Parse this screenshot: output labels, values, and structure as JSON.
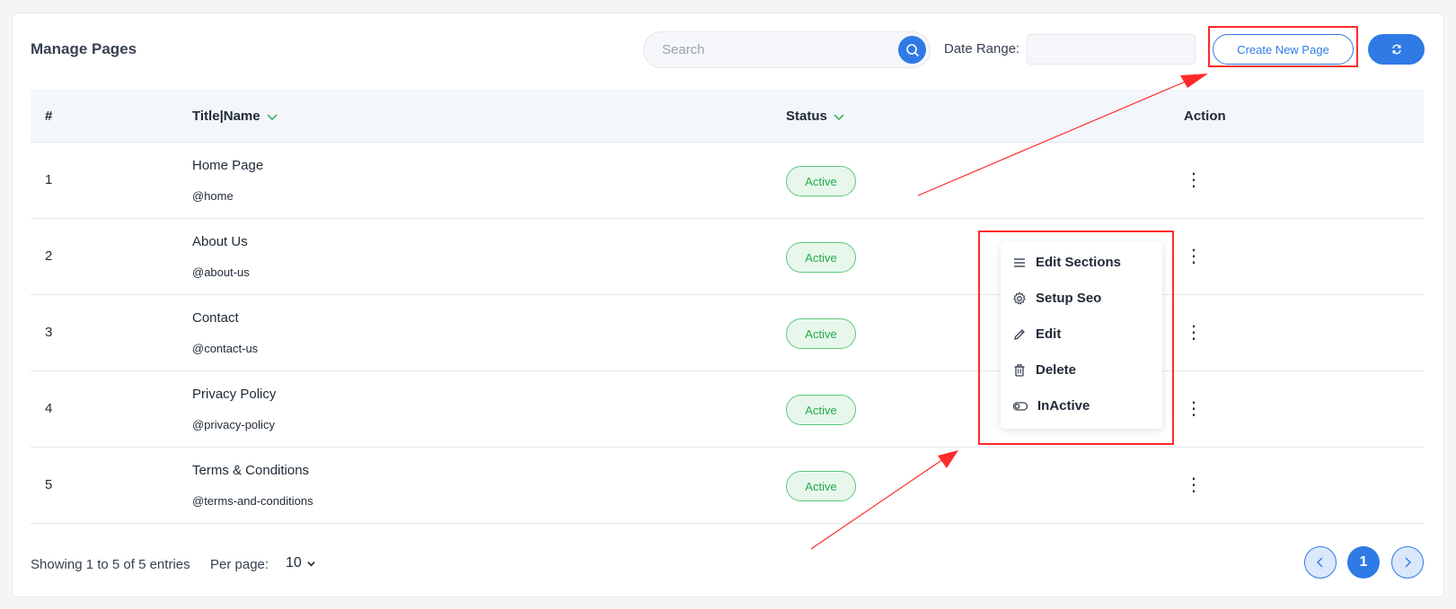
{
  "header": {
    "title": "Manage Pages",
    "search_placeholder": "Search",
    "date_range_label": "Date Range:",
    "create_label": "Create New Page"
  },
  "table": {
    "columns": {
      "num": "#",
      "title": "Title|Name",
      "status": "Status",
      "action": "Action"
    },
    "rows": [
      {
        "num": "1",
        "title": "Home Page",
        "slug": "@home",
        "status": "Active"
      },
      {
        "num": "2",
        "title": "About Us",
        "slug": "@about-us",
        "status": "Active"
      },
      {
        "num": "3",
        "title": "Contact",
        "slug": "@contact-us",
        "status": "Active"
      },
      {
        "num": "4",
        "title": "Privacy Policy",
        "slug": "@privacy-policy",
        "status": "Active"
      },
      {
        "num": "5",
        "title": "Terms & Conditions",
        "slug": "@terms-and-conditions",
        "status": "Active"
      }
    ]
  },
  "action_menu": {
    "items": [
      {
        "label": "Edit Sections",
        "icon": "list-icon"
      },
      {
        "label": "Setup Seo",
        "icon": "gear-icon"
      },
      {
        "label": "Edit",
        "icon": "pencil-icon"
      },
      {
        "label": "Delete",
        "icon": "trash-icon"
      },
      {
        "label": "InActive",
        "icon": "toggle-icon"
      }
    ]
  },
  "footer": {
    "showing": "Showing 1 to 5 of 5 entries",
    "per_page_label": "Per page:",
    "per_page_value": "10",
    "current_page": "1"
  },
  "colors": {
    "accent": "#2f7ae5",
    "active_badge": "#22a94a",
    "annotation": "#ff2a2a"
  }
}
